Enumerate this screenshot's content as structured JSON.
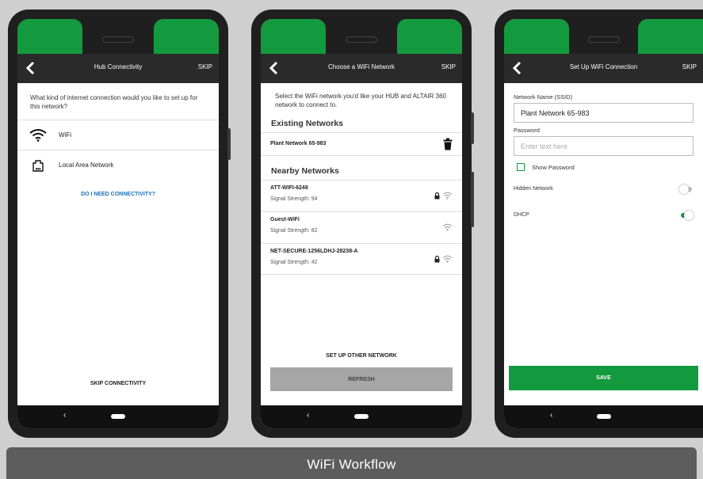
{
  "footer": {
    "caption": "WiFi Workflow"
  },
  "colors": {
    "accent_green": "#149a3e",
    "link_blue": "#1d72b8",
    "button_gray": "#a6a6a6",
    "app_bar": "#2a2a2a"
  },
  "screens": [
    {
      "appbar": {
        "title": "Hub Connectivity",
        "skip": "SKIP"
      },
      "intro": "What kind of internet connection would you like to set up for this network?",
      "options": [
        {
          "label": "WiFi",
          "icon": "wifi-icon"
        },
        {
          "label": "Local Area Network",
          "icon": "ethernet-icon"
        }
      ],
      "help_link": "DO I NEED CONNECTIVITY?",
      "bottom_action": "SKIP CONNECTIVITY",
      "nav": {
        "back": "‹"
      }
    },
    {
      "appbar": {
        "title": "Choose a WiFi Network",
        "skip": "SKIP"
      },
      "intro": "Select the WiFi network you'd like your HUB and ALTAIR 360 network to connect to.",
      "existing_title": "Existing Networks",
      "existing": [
        {
          "name": "Plant Network 65-983"
        }
      ],
      "nearby_title": "Nearby Networks",
      "nearby": [
        {
          "name": "ATT-WIFI-6248",
          "signal": "Signal Strength: 94",
          "locked": true
        },
        {
          "name": "Guest-WiFi",
          "signal": "Signal Strength: 82",
          "locked": false
        },
        {
          "name": "NET-SECURE-1256LDHJ-28238-A",
          "signal": "Signal Strength: 42",
          "locked": true
        }
      ],
      "other_network": "SET UP OTHER NETWORK",
      "refresh": "REFRESH",
      "nav": {
        "back": "‹"
      }
    },
    {
      "appbar": {
        "title": "Set Up WiFi Connection",
        "skip": "SKIP"
      },
      "ssid_label": "Network Name (SSID)",
      "ssid_value": "Plant Network 65-983",
      "password_label": "Password",
      "password_placeholder": "Enter text here",
      "show_password": "Show Password",
      "hidden_network": {
        "label": "Hidden Network",
        "on": false
      },
      "dhcp": {
        "label": "DHCP",
        "on": true
      },
      "save": "SAVE",
      "nav": {
        "back": "‹"
      }
    }
  ]
}
